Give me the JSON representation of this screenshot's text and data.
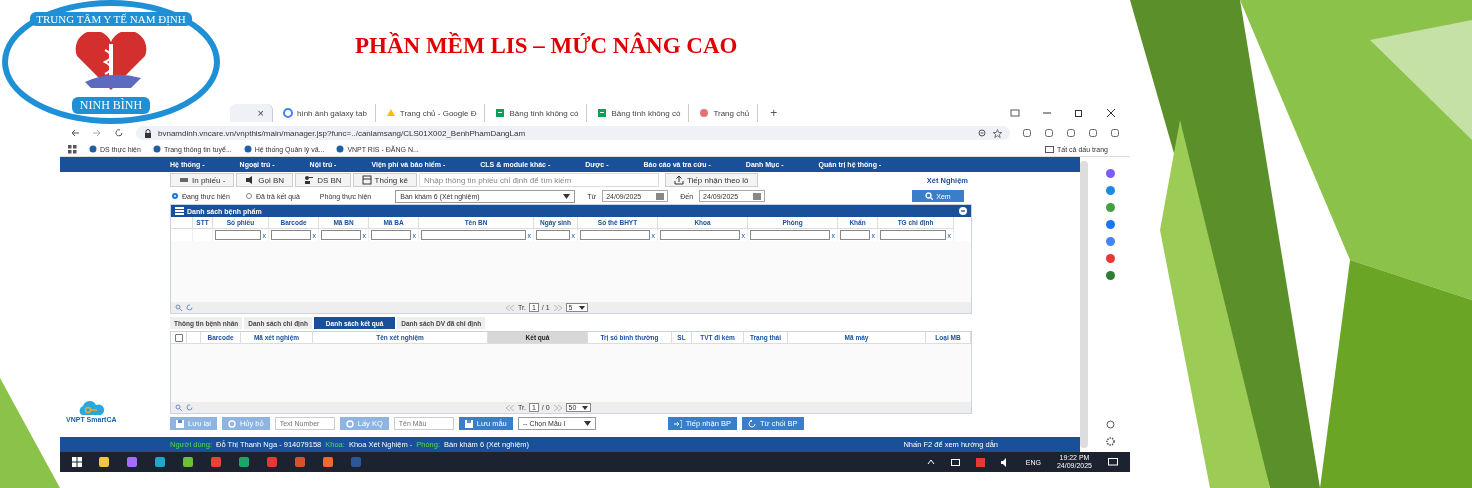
{
  "slide": {
    "title": "PHẦN MỀM LIS – MỨC NÂNG CAO",
    "logo": {
      "top_text": "TRUNG TÂM Y TẾ NAM ĐỊNH",
      "bottom_text": "NINH BÌNH"
    }
  },
  "browser": {
    "tabs": [
      {
        "kind": "blank",
        "close": "×",
        "selected": true
      },
      {
        "kind": "google",
        "label": "hình ảnh galaxy tab",
        "selected": false
      },
      {
        "kind": "drive",
        "label": "Trang chủ - Google Đ",
        "selected": false
      },
      {
        "kind": "sheets",
        "label": "Bảng tính không có",
        "selected": false
      },
      {
        "kind": "sheets",
        "label": "Bảng tính không có",
        "selected": false
      },
      {
        "kind": "web",
        "label": "Trang chủ",
        "selected": false
      }
    ],
    "new_tab": "+",
    "address": "bvnamdinh.vncare.vn/vnpthis/main/manager.jsp?func=../canlamsang/CLS01X002_BenhPhamDangLam",
    "bookmarks": [
      "DS thực hiện",
      "Trang thông tin tuyể...",
      "Hệ thống Quản lý vă...",
      "VNPT RIS - ĐĂNG N..."
    ],
    "all_bookmarks": "Tất cả dấu trang"
  },
  "app": {
    "menu": [
      "Hệ thống -",
      "Ngoại trú -",
      "Nội trú -",
      "Viện phí và bảo hiểm -",
      "CLS & module khác -",
      "Dược -",
      "Báo cáo và tra cứu -",
      "Danh Mục -",
      "Quản trị hệ thống -"
    ],
    "toolbar": {
      "buttons": [
        {
          "kind": "print",
          "label": "In phiếu -"
        },
        {
          "kind": "call",
          "label": "Gọi BN"
        },
        {
          "kind": "people",
          "label": "DS BN"
        },
        {
          "kind": "stats",
          "label": "Thống kê"
        }
      ],
      "search_placeholder": "Nhập thông tin phiếu chỉ định để tìm kiếm",
      "batch_button": "Tiếp nhận theo lô",
      "module": "Xét Nghiệm"
    },
    "filter": {
      "radios": [
        {
          "label": "Đang thực hiện",
          "selected": true
        },
        {
          "label": "Đã trả kết quả",
          "selected": false
        }
      ],
      "room_label": "Phòng thực hiện",
      "room": "Bàn khám 6 (Xét nghiệm)",
      "from_label": "Từ",
      "from": "24/09/2025",
      "to_label": "Đến",
      "to": "24/09/2025",
      "view_button": "Xem"
    },
    "specimens": {
      "title": "Danh sách bệnh phẩm",
      "columns": [
        {
          "label": "STT"
        },
        {
          "label": "Số phiếu",
          "clear": "x"
        },
        {
          "label": "Barcode",
          "clear": "x"
        },
        {
          "label": "Mã BN",
          "clear": "x"
        },
        {
          "label": "Mã BA",
          "clear": "x"
        },
        {
          "label": "Tên BN",
          "clear": "x"
        },
        {
          "label": "Ngày sinh",
          "clear": "x"
        },
        {
          "label": "Số thẻ BHYT",
          "clear": "x"
        },
        {
          "label": "Khoa",
          "clear": "x"
        },
        {
          "label": "Phòng",
          "clear": "x"
        },
        {
          "label": "Khẩn",
          "clear": "x"
        },
        {
          "label": "TG chỉ định",
          "clear": "x"
        }
      ],
      "pager": {
        "prefix": "Tr.",
        "page": "1",
        "total": "/ 1",
        "page_size": "5"
      }
    },
    "tabs": [
      {
        "label": "Thông tin bệnh nhân",
        "selected": false
      },
      {
        "label": "Danh sách chỉ định",
        "selected": false
      },
      {
        "label": "Danh sách kết quả",
        "selected": true
      },
      {
        "label": "Danh sách DV đã chỉ định",
        "selected": false
      }
    ],
    "results": {
      "select_all_checked": false,
      "columns": [
        {
          "label": "Barcode",
          "highlighted": false
        },
        {
          "label": "Mã xét nghiệm",
          "highlighted": false
        },
        {
          "label": "Tên xét nghiệm",
          "highlighted": false
        },
        {
          "label": "Kết quả",
          "highlighted": true
        },
        {
          "label": "Trị số bình thường",
          "highlighted": false
        },
        {
          "label": "SL",
          "highlighted": false
        },
        {
          "label": "TVT đi kèm",
          "highlighted": false
        },
        {
          "label": "Trạng thái",
          "highlighted": false
        },
        {
          "label": "Mã máy",
          "highlighted": false
        },
        {
          "label": "Loại MB",
          "highlighted": false
        }
      ],
      "pager": {
        "prefix": "Tr.",
        "page": "1",
        "total": "/ 0",
        "page_size": "50"
      }
    },
    "actions": [
      {
        "kind": "save",
        "label": "Lưu lại",
        "disabled": true
      },
      {
        "kind": "cancel",
        "label": "Hủy bỏ",
        "disabled": true
      },
      {
        "kind": "input",
        "placeholder": "Text Number"
      },
      {
        "kind": "cancel",
        "label": "Lấy KQ",
        "disabled": true
      },
      {
        "kind": "input",
        "placeholder": "Tên Mẫu"
      },
      {
        "kind": "save",
        "label": "Lưu mẫu",
        "disabled": false
      },
      {
        "kind": "select",
        "value": "-- Chọn Mẫu I"
      },
      {
        "kind": "spacer"
      },
      {
        "kind": "enter",
        "label": "Tiếp nhận BP",
        "disabled": false
      },
      {
        "kind": "reject",
        "label": "Từ chối BP",
        "disabled": false
      }
    ],
    "smartca": "VNPT SmartCA",
    "status": {
      "user_label": "Người dùng:",
      "user": "Đỗ Thị Thanh Nga - 914079158",
      "dept_label": "Khoa:",
      "dept": "Khoa Xét Nghiệm -",
      "room_label": "Phòng:",
      "room": "Bàn khám 6 (Xét nghiệm)",
      "hint": "Nhấn F2 để xem hướng dẫn"
    }
  },
  "taskbar": {
    "language": "ENG",
    "time": "19:22 PM",
    "date": "24/09/2025"
  }
}
